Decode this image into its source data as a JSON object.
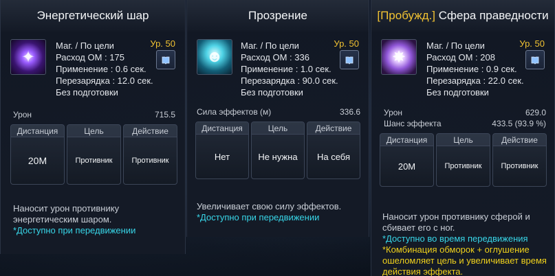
{
  "colors": {
    "level": "#f1c232",
    "highlight_cyan": "#38d6e8",
    "highlight_yellow": "#f1d21c"
  },
  "cards": [
    {
      "title": "Энергетический шар",
      "icon": "energy-orb-icon",
      "level": "Ур. 50",
      "info": [
        "Маг. / По цели",
        "Расход ОМ : 175",
        "Применение : 0.6 сек.",
        "Перезарядка : 12.0 сек.",
        "Без подготовки"
      ],
      "stats": [
        {
          "label": "Урон",
          "value": "715.5"
        }
      ],
      "boxes": [
        {
          "header": "Дистанция",
          "value": "20M"
        },
        {
          "header": "Цель",
          "value": "Противник"
        },
        {
          "header": "Действие",
          "value": "Противник"
        }
      ],
      "description": [
        "Наносит урон противнику",
        "энергетическим шаром."
      ],
      "notes": [
        "*Доступно при передвижении"
      ]
    },
    {
      "title": "Прозрение",
      "icon": "insight-icon",
      "level": "Ур. 50",
      "info": [
        "Маг. / По цели",
        "Расход ОМ : 336",
        "Применение : 1.0 сек.",
        "Перезарядка : 90.0 сек.",
        "Без подготовки"
      ],
      "stats": [
        {
          "label": "Сила эффектов (м)",
          "value": "336.6"
        }
      ],
      "boxes": [
        {
          "header": "Дистанция",
          "value": "Нет"
        },
        {
          "header": "Цель",
          "value": "Не нужна"
        },
        {
          "header": "Действие",
          "value": "На себя"
        }
      ],
      "description": [
        "Увеличивает свою силу эффектов."
      ],
      "notes": [
        "*Доступно при передвижении"
      ]
    },
    {
      "title_tag": "[Пробужд.]",
      "title": " Сфера праведности",
      "icon": "righteous-sphere-icon",
      "level": "Ур. 50",
      "info": [
        "Маг. / По цели",
        "Расход ОМ : 208",
        "Применение : 0.9 сек.",
        "Перезарядка : 22.0 сек.",
        "Без подготовки"
      ],
      "stats": [
        {
          "label": "Урон",
          "value": "629.0"
        },
        {
          "label": "Шанс эффекта",
          "value": "433.5 (93.9 %)"
        }
      ],
      "boxes": [
        {
          "header": "Дистанция",
          "value": "20M"
        },
        {
          "header": "Цель",
          "value": "Противник"
        },
        {
          "header": "Действие",
          "value": "Противник"
        }
      ],
      "description": [
        "Наносит урон противнику сферой и",
        "сбивает его с ног."
      ],
      "notes_cyan": [
        "*Доступно во время передвижения"
      ],
      "notes_yellow": [
        "*Комбинация обморок + оглушение",
        "ошеломляет цель и увеличивает время",
        "действия эффекта."
      ]
    }
  ]
}
